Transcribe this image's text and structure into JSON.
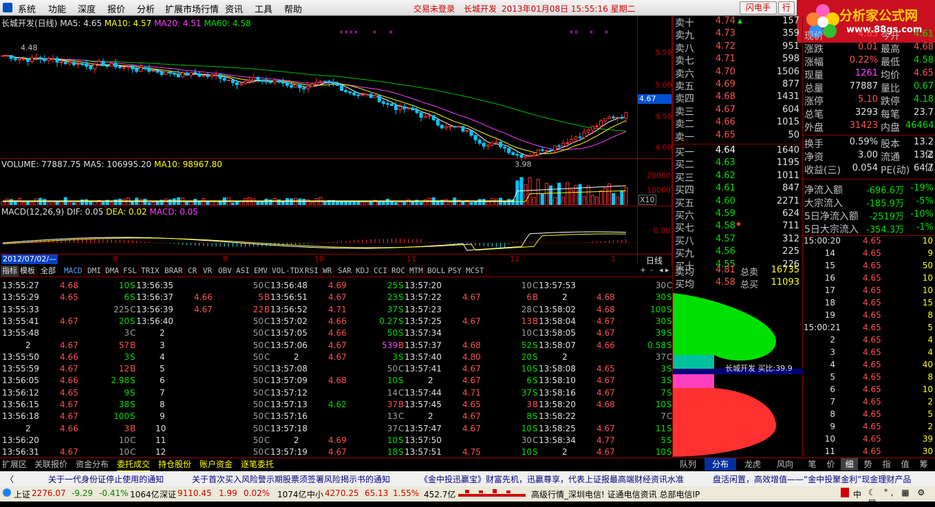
{
  "menu": [
    "系统",
    "功能",
    "深度",
    "报价",
    "分析",
    "扩展市场行情",
    "资讯",
    "工具",
    "帮助"
  ],
  "title_info": {
    "login": "交易未登录",
    "stock": "长城开发",
    "datetime": "2013年01月08日 15:55:16 星期二"
  },
  "buttons": {
    "flash": "闪电手",
    "trade": "行"
  },
  "logo": {
    "name": "分析家公式网",
    "url": "www.88gs.com"
  },
  "chart": {
    "header": {
      "title": "长城开发(日线)",
      "ma5": "MA5: 4.65",
      "ma10": "MA10: 4.57",
      "ma20": "MA20: 4.51",
      "ma60": "MA60: 4.58"
    },
    "price_axis": [
      "5.50",
      "5.00",
      "4.50",
      "4.00"
    ],
    "price_marker": "4.67",
    "high_label": "4.48",
    "low_label": "3.98",
    "volume_header": {
      "vol": "VOLUME: 77887.75",
      "ma5": "MA5: 106995.20",
      "ma10": "MA10: 98967.80"
    },
    "volume_axis": [
      "20000",
      "10000"
    ],
    "vol_unit": "X10",
    "macd_header": {
      "name": "MACD(12,26,9)",
      "dif": "DIF: 0.05",
      "dea": "DEA: 0.02",
      "macd": "MACD: 0.05"
    },
    "macd_axis": "0.00",
    "date_label": "2012/07/02/—",
    "months": [
      "8",
      "9",
      "10",
      "11",
      "12",
      "1"
    ],
    "period": "日线",
    "colors": {
      "ma5": "#ffffff",
      "ma10": "#ffff00",
      "ma20": "#ff40ff",
      "ma60": "#00c000"
    }
  },
  "chart_data": {
    "type": "candlestick",
    "title": "长城开发(日线)",
    "ylim": [
      3.9,
      5.7
    ],
    "last": 4.67,
    "high": 4.48,
    "low": 3.98
  },
  "indicator_tabs": [
    "指标",
    "模板",
    "全部",
    "MACD",
    "DMI",
    "DMA",
    "FSL",
    "TRIX",
    "BRAR",
    "CR",
    "VR",
    "OBV",
    "ASI",
    "EMV",
    "VOL-TDX",
    "RSI",
    "WR",
    "SAR",
    "KDJ",
    "CCI",
    "ROC",
    "MTM",
    "BOLL",
    "PSY",
    "MCST"
  ],
  "bottom_tabs": [
    "扩展区",
    "关联报价",
    "资金分布",
    "委托成交",
    "持仓股份",
    "账户资金",
    "逐笔委托"
  ],
  "trades": [
    [
      [
        "13:55:27",
        "4.68",
        "10",
        "S"
      ],
      [
        "13:56:35",
        "",
        "50",
        "C"
      ],
      [
        "13:56:48",
        "4.69",
        "25",
        "S"
      ],
      [
        "13:57:20",
        "",
        "10",
        "C"
      ],
      [
        "13:57:53",
        "",
        "30",
        "C"
      ]
    ],
    [
      [
        "13:55:29",
        "4.65",
        "6",
        "S"
      ],
      [
        "13:56:37",
        "4.66",
        "5",
        "B"
      ],
      [
        "13:56:51",
        "4.67",
        "23",
        "S"
      ],
      [
        "13:57:22",
        "4.67",
        "6",
        "B"
      ],
      [
        "2",
        "4.68",
        "30",
        "S"
      ]
    ],
    [
      [
        "13:55:33",
        "",
        "225",
        "C"
      ],
      [
        "13:56:39",
        "4.67",
        "22",
        "B"
      ],
      [
        "13:56:52",
        "4.71",
        "37",
        "S"
      ],
      [
        "13:57:23",
        "",
        "28",
        "C"
      ],
      [
        "13:58:02",
        "4.68",
        "100",
        "S"
      ]
    ],
    [
      [
        "13:55:41",
        "4.67",
        "20",
        "S"
      ],
      [
        "13:56:40",
        "",
        "50",
        "C"
      ],
      [
        "13:57:02",
        "4.66",
        "0.27",
        "S"
      ],
      [
        "13:57:25",
        "4.67",
        "13",
        "B"
      ],
      [
        "13:58:04",
        "4.67",
        "30",
        "S"
      ]
    ],
    [
      [
        "13:55:48",
        "",
        "3",
        "C"
      ],
      [
        "2",
        "",
        "50",
        "C"
      ],
      [
        "13:57:05",
        "4.66",
        "50",
        "S"
      ],
      [
        "13:57:34",
        "",
        "10",
        "C"
      ],
      [
        "13:58:05",
        "4.67",
        "39",
        "S"
      ]
    ],
    [
      [
        "2",
        "4.67",
        "57",
        "B"
      ],
      [
        "3",
        "",
        "50",
        "C"
      ],
      [
        "13:57:06",
        "4.67",
        "539",
        "B"
      ],
      [
        "13:57:37",
        "4.68",
        "52",
        "S"
      ],
      [
        "13:58:07",
        "4.66",
        "0.58",
        "S"
      ]
    ],
    [
      [
        "13:55:50",
        "4.66",
        "3",
        "S"
      ],
      [
        "4",
        "",
        "50",
        "C"
      ],
      [
        "2",
        "4.67",
        "3",
        "S"
      ],
      [
        "13:57:40",
        "4.80",
        "20",
        "S"
      ],
      [
        "2",
        "",
        "37",
        "C"
      ]
    ],
    [
      [
        "13:55:59",
        "4.67",
        "12",
        "B"
      ],
      [
        "5",
        "",
        "50",
        "C"
      ],
      [
        "13:57:08",
        "",
        "50",
        "C"
      ],
      [
        "13:57:41",
        "4.67",
        "10",
        "S"
      ],
      [
        "13:58:08",
        "4.65",
        "3",
        "S"
      ]
    ],
    [
      [
        "13:56:05",
        "4.66",
        "2.98",
        "S"
      ],
      [
        "6",
        "",
        "50",
        "C"
      ],
      [
        "13:57:09",
        "4.68",
        "10",
        "S"
      ],
      [
        "2",
        "4.67",
        "6",
        "S"
      ],
      [
        "13:58:10",
        "4.67",
        "3",
        "S"
      ]
    ],
    [
      [
        "13:56:12",
        "4.65",
        "9",
        "S"
      ],
      [
        "7",
        "",
        "50",
        "C"
      ],
      [
        "13:57:12",
        "",
        "14",
        "C"
      ],
      [
        "13:57:44",
        "4.71",
        "37",
        "S"
      ],
      [
        "13:58:16",
        "4.67",
        "7",
        "S"
      ]
    ],
    [
      [
        "13:56:15",
        "4.67",
        "38",
        "S"
      ],
      [
        "8",
        "",
        "50",
        "C"
      ],
      [
        "13:57:13",
        "4.62",
        "37",
        "B"
      ],
      [
        "13:57:45",
        "4.65",
        "3",
        "B"
      ],
      [
        "13:58:20",
        "4.68",
        "10",
        "S"
      ]
    ],
    [
      [
        "13:56:18",
        "4.67",
        "100",
        "S"
      ],
      [
        "9",
        "",
        "50",
        "C"
      ],
      [
        "13:57:16",
        "",
        "13",
        "C"
      ],
      [
        "2",
        "4.67",
        "8",
        "S"
      ],
      [
        "13:58:22",
        "",
        "7",
        "C"
      ]
    ],
    [
      [
        "2",
        "4.66",
        "3",
        "B"
      ],
      [
        "10",
        "",
        "50",
        "C"
      ],
      [
        "13:57:18",
        "",
        "37",
        "C"
      ],
      [
        "13:57:47",
        "4.67",
        "10",
        "S"
      ],
      [
        "13:58:25",
        "4.67",
        "11",
        "S"
      ]
    ],
    [
      [
        "13:56:20",
        "",
        "10",
        "C"
      ],
      [
        "11",
        "",
        "50",
        "C"
      ],
      [
        "2",
        "4.69",
        "10",
        "S"
      ],
      [
        "13:57:50",
        "",
        "30",
        "C"
      ],
      [
        "13:58:34",
        "4.77",
        "5",
        "S"
      ]
    ],
    [
      [
        "13:56:31",
        "4.67",
        "10",
        "C"
      ],
      [
        "12",
        "",
        "50",
        "C"
      ],
      [
        "13:57:19",
        "4.67",
        "18",
        "S"
      ],
      [
        "13:57:51",
        "4.75",
        "10",
        "S"
      ],
      [
        "2",
        "4.67",
        "10",
        "S"
      ]
    ]
  ],
  "order_book": {
    "asks": [
      [
        "卖十",
        "4.74",
        "157"
      ],
      [
        "卖九",
        "4.73",
        "359"
      ],
      [
        "卖八",
        "4.72",
        "951"
      ],
      [
        "卖七",
        "4.71",
        "598"
      ],
      [
        "卖六",
        "4.70",
        "1506"
      ],
      [
        "卖五",
        "4.69",
        "877"
      ],
      [
        "卖四",
        "4.68",
        "1431"
      ],
      [
        "卖三",
        "4.67",
        "604"
      ],
      [
        "卖二",
        "4.66",
        "1015"
      ],
      [
        "卖一",
        "4.65",
        "50"
      ]
    ],
    "bids": [
      [
        "买一",
        "4.64",
        "1640"
      ],
      [
        "买二",
        "4.63",
        "1195"
      ],
      [
        "买三",
        "4.62",
        "1011"
      ],
      [
        "买四",
        "4.61",
        "847"
      ],
      [
        "买五",
        "4.60",
        "2271"
      ],
      [
        "买六",
        "4.59",
        "624"
      ],
      [
        "买七",
        "4.58",
        "711"
      ],
      [
        "买八",
        "4.57",
        "312"
      ],
      [
        "买九",
        "4.56",
        "225"
      ],
      [
        "买十",
        "4.55",
        "226"
      ]
    ],
    "summary": [
      [
        "卖均",
        "4.81",
        "总卖",
        "16735"
      ],
      [
        "买均",
        "4.58",
        "总买",
        "11093"
      ]
    ]
  },
  "stats": [
    [
      "现价",
      "4.65",
      "今开",
      "4.61"
    ],
    [
      "涨跌",
      "0.01",
      "最高",
      "4.68"
    ],
    [
      "涨幅",
      "0.22%",
      "最低",
      "4.58"
    ],
    [
      "现量",
      "1261",
      "均价",
      "4.65"
    ],
    [
      "总量",
      "77887",
      "量比",
      "0.67"
    ],
    [
      "涨停",
      "5.10",
      "跌停",
      "4.18"
    ],
    [
      "总笔",
      "3293",
      "每笔",
      "23.7"
    ],
    [
      "外盘",
      "31423",
      "内盘",
      "46464"
    ],
    [
      "换手",
      "0.59%",
      "股本",
      "13.2亿"
    ],
    [
      "净资",
      "3.00",
      "流通",
      "13.2亿"
    ],
    [
      "收益(三)",
      "0.054",
      "PE(动)",
      "64.7"
    ]
  ],
  "flows": [
    [
      "净流入额",
      "-696.6万",
      "-19%"
    ],
    [
      "大宗流入",
      "-185.9万",
      "-5%"
    ],
    [
      "5日净流入额",
      "-2519万",
      "-10%"
    ],
    [
      "5日大宗流入",
      "-354.3万",
      "-1%"
    ]
  ],
  "tick_list": [
    [
      "15:00:20",
      "4.65",
      "10"
    ],
    [
      "14",
      "4.65",
      "9"
    ],
    [
      "15",
      "4.65",
      "50"
    ],
    [
      "16",
      "4.65",
      "10"
    ],
    [
      "17",
      "4.65",
      "10"
    ],
    [
      "18",
      "4.65",
      "15"
    ],
    [
      "19",
      "4.65",
      "8"
    ],
    [
      "15:00:21",
      "4.65",
      "5"
    ],
    [
      "2",
      "4.65",
      "4"
    ],
    [
      "3",
      "4.65",
      "4"
    ],
    [
      "4",
      "4.65",
      "40"
    ],
    [
      "5",
      "4.65",
      "8"
    ],
    [
      "6",
      "4.65",
      "10"
    ],
    [
      "7",
      "4.65",
      "2"
    ],
    [
      "8",
      "4.65",
      "5"
    ],
    [
      "9",
      "4.65",
      "2"
    ],
    [
      "10",
      "4.65",
      "39"
    ],
    [
      "11",
      "4.65",
      "30"
    ]
  ],
  "chip": {
    "label": "长城开发 买比:39.9"
  },
  "right_tabs": [
    "队列",
    "分布",
    "龙虎",
    "风向"
  ],
  "mini_tabs": [
    "笔",
    "价",
    "细",
    "势",
    "指",
    "值",
    "筹"
  ],
  "news": [
    "关于一代身份证停止使用的通知",
    "关于首次买入风险警示期股票须签署风险揭示书的通知",
    "《金中投迅赢宝》财富先机，迅赢尊享，代表上证报最高端财经资讯水准",
    "盘活闲置，高效增值——“金中投聚金利”现金理财产品"
  ],
  "status": {
    "sh_label": "上证",
    "sh_val": "2276.07",
    "sh_chg": "-9.29",
    "sh_pct": "-0.41%",
    "sh_amt": "1064亿",
    "sz_label": "深证",
    "sz_val": "9110.45",
    "sz_chg": "1.99",
    "sz_pct": "0.02%",
    "sz_amt": "1074亿",
    "zx_label": "中小",
    "zx_val": "4270.25",
    "zx_chg": "65.13",
    "zx_pct": "1.55%",
    "zx_amt": "452.7亿",
    "info": "高级行情_深圳电信! 证通电信资讯 总部电信IP",
    "ime": "中"
  }
}
